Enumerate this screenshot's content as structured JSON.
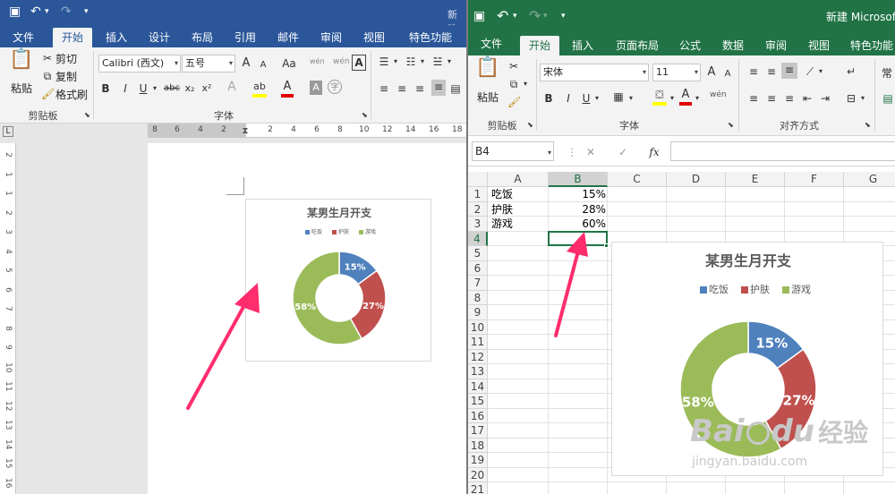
{
  "word": {
    "title_fragment": "新建",
    "tabs": [
      "文件",
      "开始",
      "插入",
      "设计",
      "布局",
      "引用",
      "邮件",
      "审阅",
      "视图",
      "特色功能"
    ],
    "active_tab": "开始",
    "clipboard": {
      "paste": "粘贴",
      "cut": "剪切",
      "copy": "复制",
      "format_painter": "格式刷",
      "group": "剪贴板"
    },
    "font": {
      "name": "Calibri (西文)",
      "size": "五号",
      "group": "字体",
      "bold": "B",
      "italic": "I",
      "underline": "U",
      "strike": "abc",
      "sub": "x₂",
      "sup": "x²",
      "change_case": "Aa",
      "grow": "A",
      "shrink": "A",
      "phonetic": "wén",
      "clear": "A",
      "text_effect": "A",
      "highlight": "ab",
      "color": "A",
      "shade": "A",
      "enclose": "字"
    },
    "ruler": {
      "h_numbers": [
        "8",
        "6",
        "4",
        "2",
        "2",
        "4",
        "6",
        "8",
        "10",
        "12",
        "14",
        "16",
        "18"
      ],
      "v_numbers": [
        "2",
        "1",
        "1",
        "2",
        "3",
        "4",
        "5",
        "6",
        "7",
        "8",
        "9",
        "10",
        "11",
        "12",
        "13",
        "14",
        "15",
        "16"
      ]
    }
  },
  "excel": {
    "title_fragment": "新建 Microsoft E",
    "tabs": [
      "文件",
      "开始",
      "插入",
      "页面布局",
      "公式",
      "数据",
      "审阅",
      "视图",
      "特色功能"
    ],
    "active_tab": "开始",
    "clipboard": {
      "paste": "粘贴",
      "group": "剪贴板"
    },
    "font": {
      "name": "宋体",
      "size": "11",
      "group": "字体",
      "bold": "B",
      "italic": "I",
      "underline": "U",
      "phonetic": "wén"
    },
    "alignment": {
      "group": "对齐方式"
    },
    "number_format_fragment": "常",
    "name_box": "B4",
    "formula_buttons": {
      "cancel": "✕",
      "enter": "✓",
      "fx": "fx"
    },
    "formula_value": "",
    "columns": [
      "A",
      "B",
      "C",
      "D",
      "E",
      "F",
      "G"
    ],
    "rows": [
      "1",
      "2",
      "3",
      "4",
      "5",
      "6",
      "7",
      "8",
      "9",
      "10",
      "11",
      "12",
      "13",
      "14",
      "15",
      "16",
      "17",
      "18",
      "19",
      "20",
      "21"
    ],
    "cells": [
      {
        "label": "吃饭",
        "value": "15%"
      },
      {
        "label": "护肤",
        "value": "28%"
      },
      {
        "label": "游戏",
        "value": "60%"
      }
    ]
  },
  "chart_data": [
    {
      "type": "pie",
      "title": "某男生月开支",
      "categories": [
        "吃饭",
        "护肤",
        "游戏"
      ],
      "values": [
        15,
        27,
        58
      ],
      "data_labels": [
        "15%",
        "27%",
        "58%"
      ],
      "colors": [
        "#4f81bd",
        "#c0504d",
        "#9bbb59"
      ],
      "legend": "top"
    },
    {
      "type": "pie",
      "title": "某男生月开支",
      "categories": [
        "吃饭",
        "护肤",
        "游戏"
      ],
      "values": [
        15,
        27,
        58
      ],
      "data_labels": [
        "15%",
        "27%",
        "58%"
      ],
      "colors": [
        "#4f81bd",
        "#c0504d",
        "#9bbb59"
      ],
      "legend": "top"
    }
  ],
  "watermark": {
    "brand": "Bai",
    "brand2": "du",
    "text": "经验",
    "url": "jingyan.baidu.com"
  }
}
